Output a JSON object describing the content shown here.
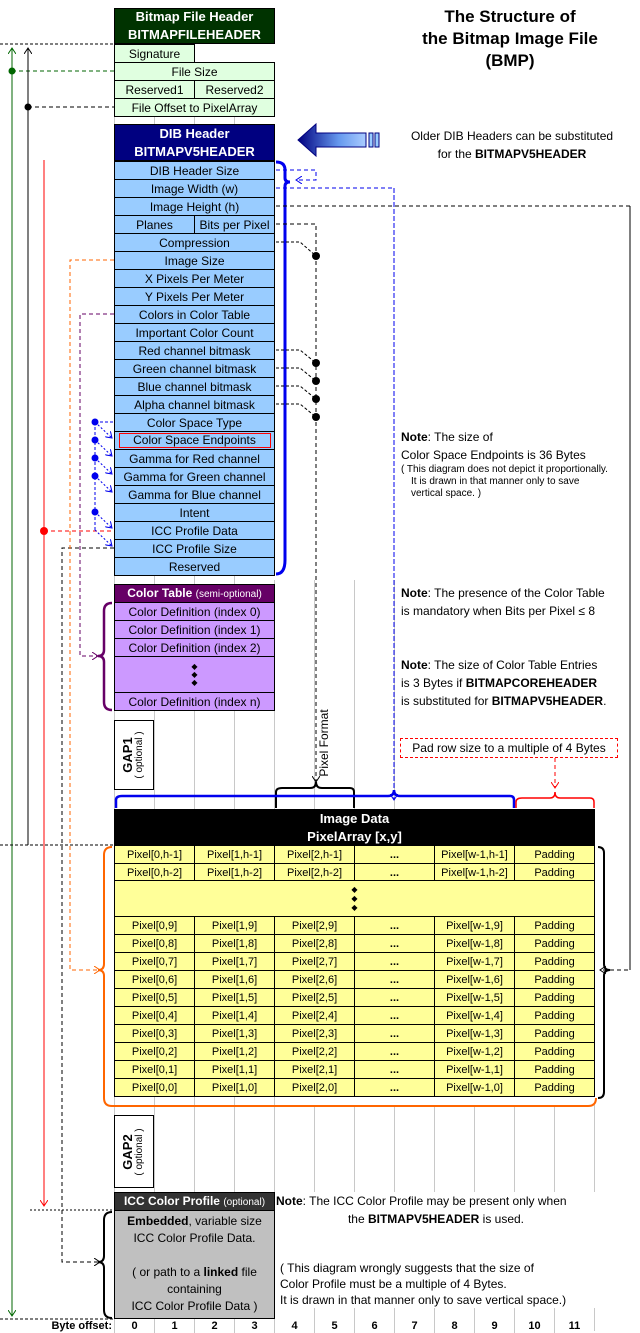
{
  "title": {
    "line1": "The Structure of",
    "line2": "the Bitmap Image File",
    "line3": "(BMP)"
  },
  "file_header": {
    "title": "Bitmap File Header",
    "subtitle": "BITMAPFILEHEADER",
    "color": "#003300",
    "fields": {
      "signature": "Signature",
      "file_size": "File Size",
      "reserved1": "Reserved1",
      "reserved2": "Reserved2",
      "file_offset": "File Offset to PixelArray"
    }
  },
  "dib_header": {
    "title": "DIB Header",
    "subtitle": "BITMAPV5HEADER",
    "color": "#000080",
    "fields": [
      "DIB Header Size",
      "Image Width (w)",
      "Image Height (h)",
      "Planes",
      "Bits per Pixel",
      "Compression",
      "Image Size",
      "X Pixels Per Meter",
      "Y Pixels Per Meter",
      "Colors in Color Table",
      "Important Color Count",
      "Red channel bitmask",
      "Green channel bitmask",
      "Blue channel bitmask",
      "Alpha channel bitmask",
      "Color Space Type",
      "Color Space Endpoints",
      "Gamma for Red channel",
      "Gamma for Green channel",
      "Gamma for Blue channel",
      "Intent",
      "ICC Profile Data",
      "ICC Profile Size",
      "Reserved"
    ]
  },
  "substitution_note": {
    "line1": "Older DIB Headers can be substituted",
    "line2_pre": "for the ",
    "line2_bold": "BITMAPV5HEADER"
  },
  "color_table": {
    "title": "Color Table",
    "qualifier": "(semi-optional)",
    "color": "#660066",
    "entries": [
      "Color Definition (index 0)",
      "Color Definition (index 1)",
      "Color Definition (index 2)",
      "Color Definition (index n)"
    ]
  },
  "notes": {
    "endpoints": {
      "bold": "Note",
      "l1": ": The size of",
      "l2": "Color Space Endpoints is 36 Bytes",
      "l3": "( This diagram does not depict it proportionally.",
      "l4": "It is drawn in that manner only to save",
      "l5": "vertical space. )"
    },
    "color_table_presence": {
      "bold": "Note",
      "l1": ": The presence of the Color Table",
      "l2": "is mandatory when Bits per Pixel ≤ 8"
    },
    "color_table_size": {
      "bold": "Note",
      "l1": ": The size of Color Table Entries",
      "l2_pre": "is 3 Bytes if ",
      "l2_bold": "BITMAPCOREHEADER",
      "l3_pre": "is substituted for ",
      "l3_bold": "BITMAPV5HEADER",
      "l3_post": "."
    },
    "icc": {
      "bold": "Note",
      "l1": ": The ICC Color Profile may be present only when",
      "l2_pre": "the ",
      "l2_bold": "BITMAPV5HEADER",
      "l2_post": " is used.",
      "l3": "( This diagram wrongly suggests that the size of",
      "l4": "Color Profile must be a multiple of 4 Bytes.",
      "l5": "It is drawn in that manner only to save vertical space.)"
    }
  },
  "labels": {
    "pixel_format": "Pixel Format",
    "pad_row": "Pad row size to a multiple of 4 Bytes",
    "gap1": "GAP1",
    "gap2": "GAP2",
    "optional": "( optional )"
  },
  "image_data": {
    "title": "Image Data",
    "subtitle": "PixelArray [x,y]",
    "ellipsis": "...",
    "rows_top": [
      [
        "Pixel[0,h-1]",
        "Pixel[1,h-1]",
        "Pixel[2,h-1]",
        "...",
        "Pixel[w-1,h-1]",
        "Padding"
      ],
      [
        "Pixel[0,h-2]",
        "Pixel[1,h-2]",
        "Pixel[2,h-2]",
        "...",
        "Pixel[w-1,h-2]",
        "Padding"
      ]
    ],
    "rows_bottom": [
      [
        "Pixel[0,9]",
        "Pixel[1,9]",
        "Pixel[2,9]",
        "...",
        "Pixel[w-1,9]",
        "Padding"
      ],
      [
        "Pixel[0,8]",
        "Pixel[1,8]",
        "Pixel[2,8]",
        "...",
        "Pixel[w-1,8]",
        "Padding"
      ],
      [
        "Pixel[0,7]",
        "Pixel[1,7]",
        "Pixel[2,7]",
        "...",
        "Pixel[w-1,7]",
        "Padding"
      ],
      [
        "Pixel[0,6]",
        "Pixel[1,6]",
        "Pixel[2,6]",
        "...",
        "Pixel[w-1,6]",
        "Padding"
      ],
      [
        "Pixel[0,5]",
        "Pixel[1,5]",
        "Pixel[2,5]",
        "...",
        "Pixel[w-1,5]",
        "Padding"
      ],
      [
        "Pixel[0,4]",
        "Pixel[1,4]",
        "Pixel[2,4]",
        "...",
        "Pixel[w-1,4]",
        "Padding"
      ],
      [
        "Pixel[0,3]",
        "Pixel[1,3]",
        "Pixel[2,3]",
        "...",
        "Pixel[w-1,3]",
        "Padding"
      ],
      [
        "Pixel[0,2]",
        "Pixel[1,2]",
        "Pixel[2,2]",
        "...",
        "Pixel[w-1,2]",
        "Padding"
      ],
      [
        "Pixel[0,1]",
        "Pixel[1,1]",
        "Pixel[2,1]",
        "...",
        "Pixel[w-1,1]",
        "Padding"
      ],
      [
        "Pixel[0,0]",
        "Pixel[1,0]",
        "Pixel[2,0]",
        "...",
        "Pixel[w-1,0]",
        "Padding"
      ]
    ]
  },
  "icc_profile": {
    "title": "ICC Color Profile",
    "qualifier": "(optional)",
    "l1_bold": "Embedded",
    "l1_post": ", variable size",
    "l2": "ICC Color Profile Data.",
    "l3_pre": "( or path to a ",
    "l3_bold": "linked",
    "l3_post": " file",
    "l4": "containing",
    "l5": "ICC Color Profile Data )"
  },
  "byte_offset": {
    "label": "Byte offset:",
    "values": [
      "0",
      "1",
      "2",
      "3",
      "4",
      "5",
      "6",
      "7",
      "8",
      "9",
      "10",
      "11"
    ]
  },
  "colors": {
    "file_header_fill": "#e0ffe0",
    "dib_fill": "#99ccff",
    "color_table_fill": "#cc99ff",
    "pixel_fill": "#ffff99",
    "icc_fill": "#c0c0c0",
    "highlight_red": "#ff0000",
    "orange": "#ff6600"
  }
}
